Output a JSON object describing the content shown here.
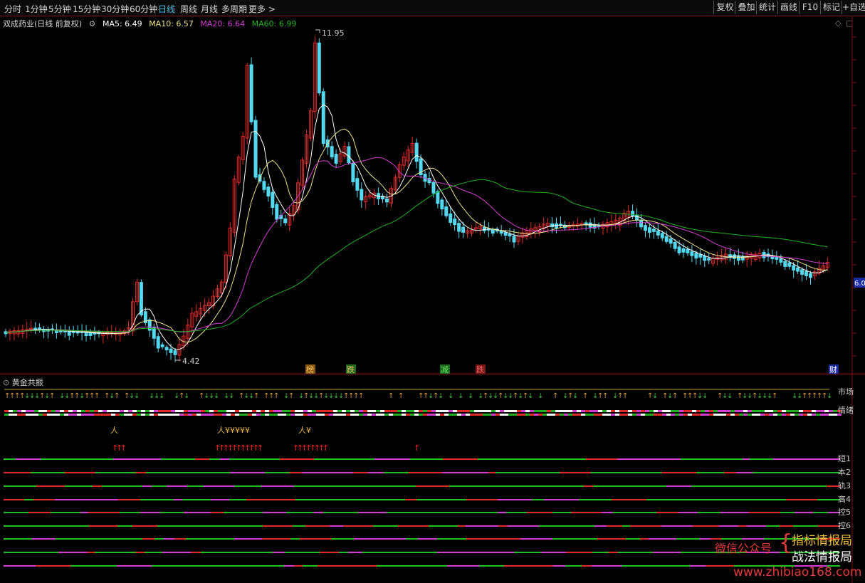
{
  "toolbar": {
    "periods": [
      "分时",
      "1分钟",
      "5分钟",
      "15分钟",
      "30分钟",
      "60分钟",
      "日线",
      "周线",
      "月线",
      "多周期",
      "更多 >"
    ],
    "active_period": "日线",
    "right_buttons": [
      "复权",
      "叠加",
      "统计",
      "画线",
      "F10",
      "标记",
      "+自选"
    ]
  },
  "info": {
    "stock_title": "双成药业(日线 前复权)",
    "ma5": "MA5: 6.49",
    "ma10": "MA10: 6.57",
    "ma20": "MA20: 6.64",
    "ma60": "MA60: 6.99",
    "colors": {
      "ma5": "#ffffff",
      "ma10": "#f0e28a",
      "ma20": "#d23dd2",
      "ma60": "#22b022"
    }
  },
  "chart": {
    "high_label": "11.95",
    "low_label": "4.42",
    "price_tag": "6.0",
    "event_tags": [
      "榜",
      "跌",
      "减",
      "跌",
      "财"
    ],
    "colors": {
      "up": "#e02a2a",
      "down": "#54d8f0",
      "grid": "#5a0a0a",
      "axis": "#7a1010"
    }
  },
  "panel": {
    "title": "黄金共振",
    "row_labels": [
      "市场",
      "情绪",
      "短1",
      "本2",
      "轨3",
      "高4",
      "控5",
      "控6"
    ],
    "signal_groups": [
      {
        "glyph": "人",
        "count": 1
      },
      {
        "glyph": "人",
        "count": 1
      },
      {
        "glyph": "¥",
        "count": 5
      },
      {
        "glyph": "人",
        "count": 1
      },
      {
        "glyph": "¥",
        "count": 1
      }
    ]
  },
  "watermark": {
    "left": "微信公众号",
    "line1": "指标情报局",
    "line2": "战法情报局",
    "url": "www.zhibiao168.com"
  }
}
